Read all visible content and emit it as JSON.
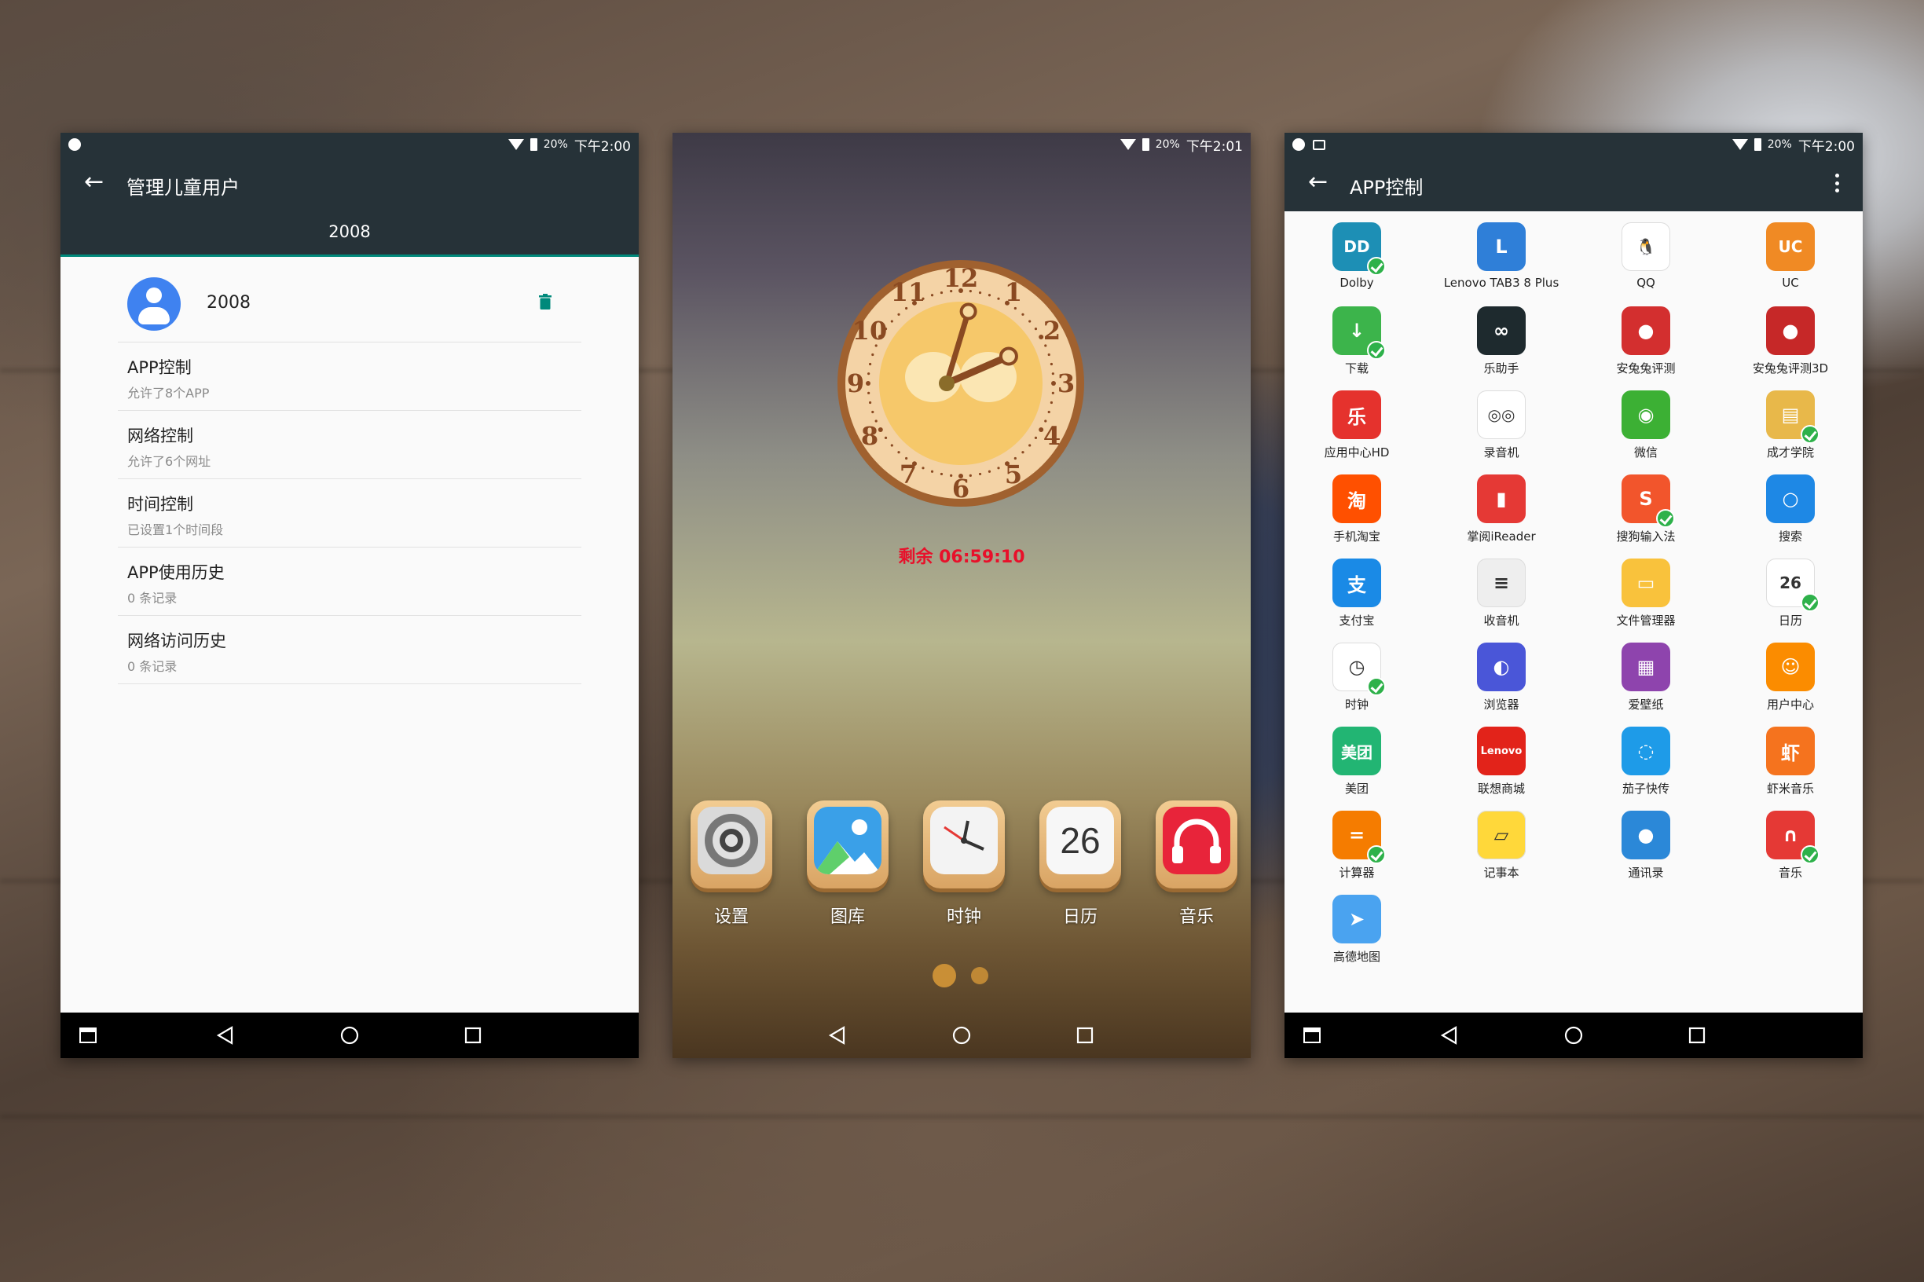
{
  "colors": {
    "appbar": "#263238",
    "accent": "#00897b",
    "avatar": "#3f82f0",
    "remaining_text": "#e8102a",
    "check_badge": "#2eb14a"
  },
  "phone1": {
    "status": {
      "battery": "20%",
      "time": "下午2:00"
    },
    "title": "管理儿童用户",
    "tab": "2008",
    "user": {
      "name": "2008"
    },
    "menu": [
      {
        "title": "APP控制",
        "subtitle": "允许了8个APP"
      },
      {
        "title": "网络控制",
        "subtitle": "允许了6个网址"
      },
      {
        "title": "时间控制",
        "subtitle": "已设置1个时间段"
      },
      {
        "title": "APP使用历史",
        "subtitle": "0 条记录"
      },
      {
        "title": "网络访问历史",
        "subtitle": "0 条记录"
      }
    ]
  },
  "phone2": {
    "status": {
      "battery": "20%",
      "time": "下午2:01"
    },
    "clock": {
      "hour": 2,
      "minute": 1,
      "numerals": [
        "12",
        "1",
        "2",
        "3",
        "4",
        "5",
        "6",
        "7",
        "8",
        "9",
        "10",
        "11"
      ]
    },
    "remaining": "剩余 06:59:10",
    "dock": [
      {
        "label": "设置",
        "icon": "gear-icon"
      },
      {
        "label": "图库",
        "icon": "gallery-icon"
      },
      {
        "label": "时钟",
        "icon": "clock-icon"
      },
      {
        "label": "日历",
        "icon": "calendar-icon",
        "date": "26"
      },
      {
        "label": "音乐",
        "icon": "headphones-icon"
      }
    ],
    "pages": 2,
    "current_page": 1
  },
  "phone3": {
    "status": {
      "battery": "20%",
      "time": "下午2:00"
    },
    "title": "APP控制",
    "apps": [
      {
        "label": "Dolby",
        "glyph": "DD",
        "color": "#1d8fb5",
        "checked": true
      },
      {
        "label": "Lenovo TAB3 8 Plus",
        "glyph": "L",
        "color": "#2f7fd8",
        "checked": false
      },
      {
        "label": "QQ",
        "glyph": "🐧",
        "color": "#ffffff",
        "checked": false
      },
      {
        "label": "UC",
        "glyph": "UC",
        "color": "#f08a24",
        "checked": false
      },
      {
        "label": "下载",
        "glyph": "↓",
        "color": "#3cb44b",
        "checked": true
      },
      {
        "label": "乐助手",
        "glyph": "∞",
        "color": "#1e2a2e",
        "checked": false
      },
      {
        "label": "安兔兔评测",
        "glyph": "●",
        "color": "#d32f2f",
        "checked": false
      },
      {
        "label": "安兔兔评测3D",
        "glyph": "●",
        "color": "#c62828",
        "checked": false
      },
      {
        "label": "应用中心HD",
        "glyph": "乐",
        "color": "#e5322d",
        "checked": false
      },
      {
        "label": "录音机",
        "glyph": "◎◎",
        "color": "#ffffff",
        "checked": false
      },
      {
        "label": "微信",
        "glyph": "◉",
        "color": "#3cb034",
        "checked": false
      },
      {
        "label": "成才学院",
        "glyph": "▤",
        "color": "#e8b84a",
        "checked": true
      },
      {
        "label": "手机淘宝",
        "glyph": "淘",
        "color": "#ff5000",
        "checked": false
      },
      {
        "label": "掌阅iReader",
        "glyph": "▮",
        "color": "#e53935",
        "checked": false
      },
      {
        "label": "搜狗输入法",
        "glyph": "S",
        "color": "#f2552c",
        "checked": true
      },
      {
        "label": "搜索",
        "glyph": "○",
        "color": "#1e88e5",
        "checked": false
      },
      {
        "label": "支付宝",
        "glyph": "支",
        "color": "#1a8ae6",
        "checked": false
      },
      {
        "label": "收音机",
        "glyph": "≡",
        "color": "#eeeeee",
        "checked": false
      },
      {
        "label": "文件管理器",
        "glyph": "▭",
        "color": "#f9c23c",
        "checked": false
      },
      {
        "label": "日历",
        "glyph": "26",
        "color": "#ffffff",
        "checked": true
      },
      {
        "label": "时钟",
        "glyph": "◷",
        "color": "#ffffff",
        "checked": true
      },
      {
        "label": "浏览器",
        "glyph": "◐",
        "color": "#4a56d8",
        "checked": false
      },
      {
        "label": "爱壁纸",
        "glyph": "▦",
        "color": "#8e44ad",
        "checked": false
      },
      {
        "label": "用户中心",
        "glyph": "☺",
        "color": "#fb8c00",
        "checked": false
      },
      {
        "label": "美团",
        "glyph": "美团",
        "color": "#22b573",
        "checked": false
      },
      {
        "label": "联想商城",
        "glyph": "Lenovo",
        "color": "#e2231a",
        "checked": false
      },
      {
        "label": "茄子快传",
        "glyph": "◌",
        "color": "#1e9be8",
        "checked": false
      },
      {
        "label": "虾米音乐",
        "glyph": "虾",
        "color": "#f5731e",
        "checked": false
      },
      {
        "label": "计算器",
        "glyph": "=",
        "color": "#f57c00",
        "checked": true
      },
      {
        "label": "记事本",
        "glyph": "▱",
        "color": "#ffd83a",
        "checked": false
      },
      {
        "label": "通讯录",
        "glyph": "●",
        "color": "#2b88d8",
        "checked": false
      },
      {
        "label": "音乐",
        "glyph": "∩",
        "color": "#e53935",
        "checked": true
      },
      {
        "label": "高德地图",
        "glyph": "➤",
        "color": "#4aa3f0",
        "checked": false
      }
    ]
  }
}
